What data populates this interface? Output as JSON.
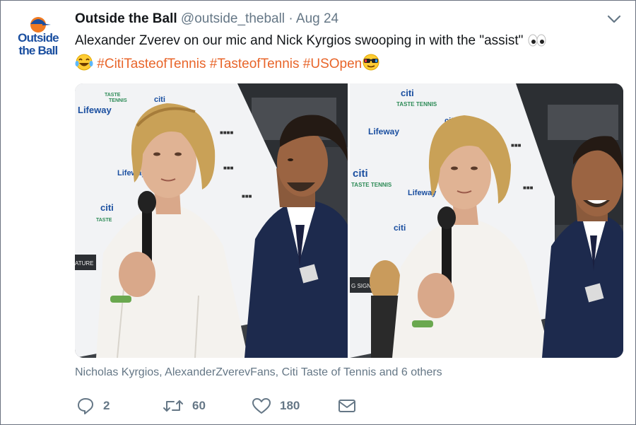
{
  "tweet": {
    "author_name": "Outside the Ball",
    "handle": "@outside_theball",
    "separator": "·",
    "date": "Aug 24",
    "text_main": "Alexander Zverev on our mic and Nick Kyrgios swooping in with the \"assist\"",
    "hashtags": [
      "#CitiTasteofTennis",
      "#TasteofTennis",
      "#USOpen"
    ],
    "likers_text": "Nicholas Kyrgios, AlexanderZverevFans, Citi Taste of Tennis and 6 others",
    "actions": {
      "reply_count": "2",
      "retweet_count": "60",
      "like_count": "180"
    }
  },
  "avatar": {
    "line1": "Outside",
    "line2": "the Ball"
  },
  "photos": {
    "left": {
      "backdrop_logos": [
        "Lifeway",
        "citi",
        "TASTE TENNIS",
        "citi",
        "Lifeway",
        "ATURE"
      ]
    },
    "right": {
      "backdrop_logos": [
        "citi",
        "TASTE TENNIS",
        "Lifeway",
        "citi",
        "TASTE TENNIS",
        "Lifeway",
        "citi",
        "G SIGNAT"
      ]
    }
  },
  "icons": {
    "caret": "chevron-down-icon",
    "reply": "reply-icon",
    "retweet": "retweet-icon",
    "like": "heart-icon",
    "dm": "envelope-icon"
  },
  "colors": {
    "hashtag": "#e8652a",
    "brand_blue": "#1b4fa0",
    "brand_orange": "#f07a22",
    "muted": "#657786"
  }
}
